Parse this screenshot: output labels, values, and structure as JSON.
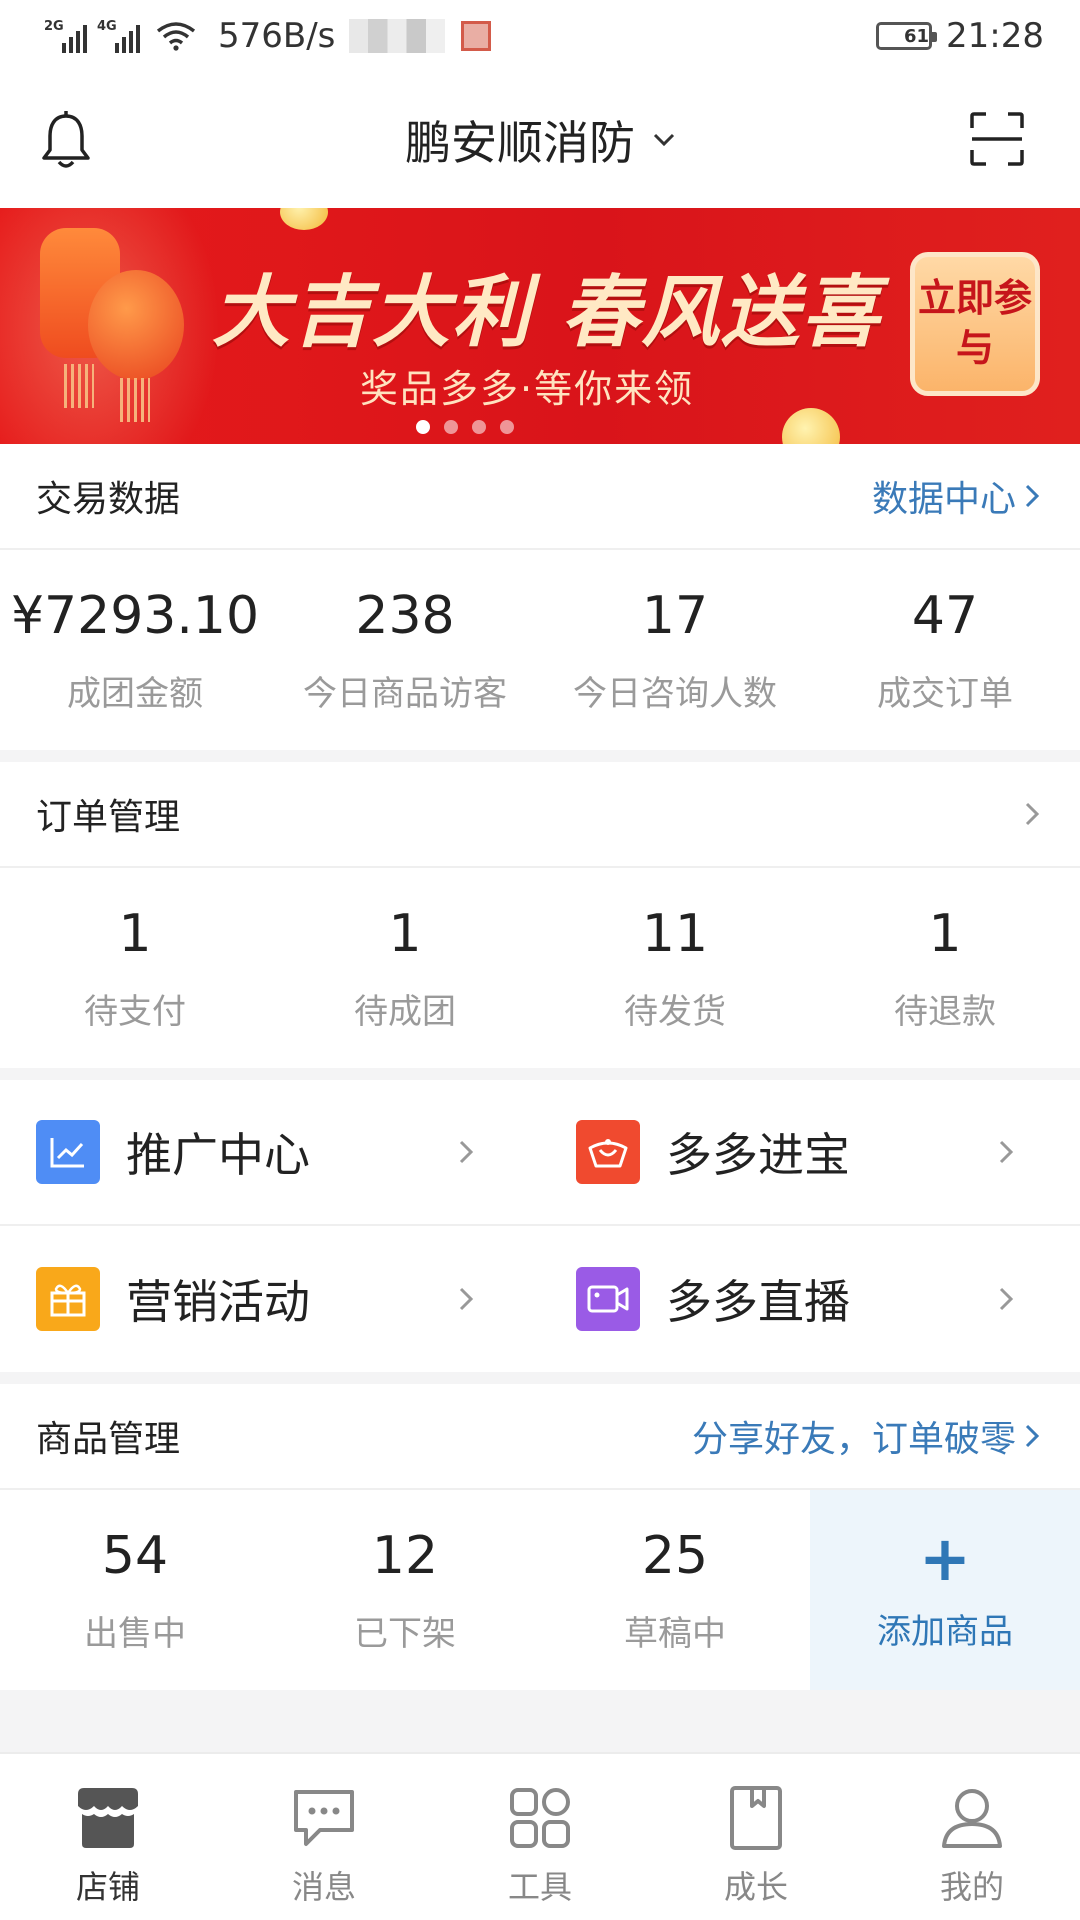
{
  "status_bar": {
    "net1": "2G",
    "net2": "4G",
    "speed": "576B/s",
    "battery": "61",
    "battery_level": 0.61,
    "time": "21:28"
  },
  "header": {
    "shop_name": "鹏安顺消防"
  },
  "banner": {
    "title": "大吉大利 春风送喜",
    "subtitle": "奖品多多·等你来领",
    "cta": "立即参与",
    "slide_count": 4,
    "active_slide": 0
  },
  "trade": {
    "title": "交易数据",
    "link": "数据中心",
    "stats": [
      {
        "value": "¥7293.10",
        "label": "成团金额"
      },
      {
        "value": "238",
        "label": "今日商品访客"
      },
      {
        "value": "17",
        "label": "今日咨询人数"
      },
      {
        "value": "47",
        "label": "成交订单"
      }
    ]
  },
  "orders": {
    "title": "订单管理",
    "stats": [
      {
        "value": "1",
        "label": "待支付"
      },
      {
        "value": "1",
        "label": "待成团"
      },
      {
        "value": "11",
        "label": "待发货"
      },
      {
        "value": "1",
        "label": "待退款"
      }
    ]
  },
  "features": [
    {
      "label": "推广中心",
      "icon": "chart-icon",
      "color": "#4f8df5"
    },
    {
      "label": "多多进宝",
      "icon": "ingot-icon",
      "color": "#f04a2f"
    },
    {
      "label": "营销活动",
      "icon": "gift-icon",
      "color": "#f9a81a"
    },
    {
      "label": "多多直播",
      "icon": "video-camera-icon",
      "color": "#9a5be6"
    }
  ],
  "goods": {
    "title": "商品管理",
    "link": "分享好友，订单破零",
    "stats": [
      {
        "value": "54",
        "label": "出售中"
      },
      {
        "value": "12",
        "label": "已下架"
      },
      {
        "value": "25",
        "label": "草稿中"
      }
    ],
    "add_plus": "+",
    "add_label": "添加商品"
  },
  "tabs": [
    {
      "label": "店铺",
      "icon": "shop-icon",
      "active": true
    },
    {
      "label": "消息",
      "icon": "chat-bubble-icon",
      "active": false
    },
    {
      "label": "工具",
      "icon": "grid-icon",
      "active": false
    },
    {
      "label": "成长",
      "icon": "book-icon",
      "active": false
    },
    {
      "label": "我的",
      "icon": "user-icon",
      "active": false
    }
  ],
  "colors": {
    "link_blue": "#3a7ab8",
    "banner_red": "#d9141a",
    "add_bg": "#edf5fb"
  }
}
